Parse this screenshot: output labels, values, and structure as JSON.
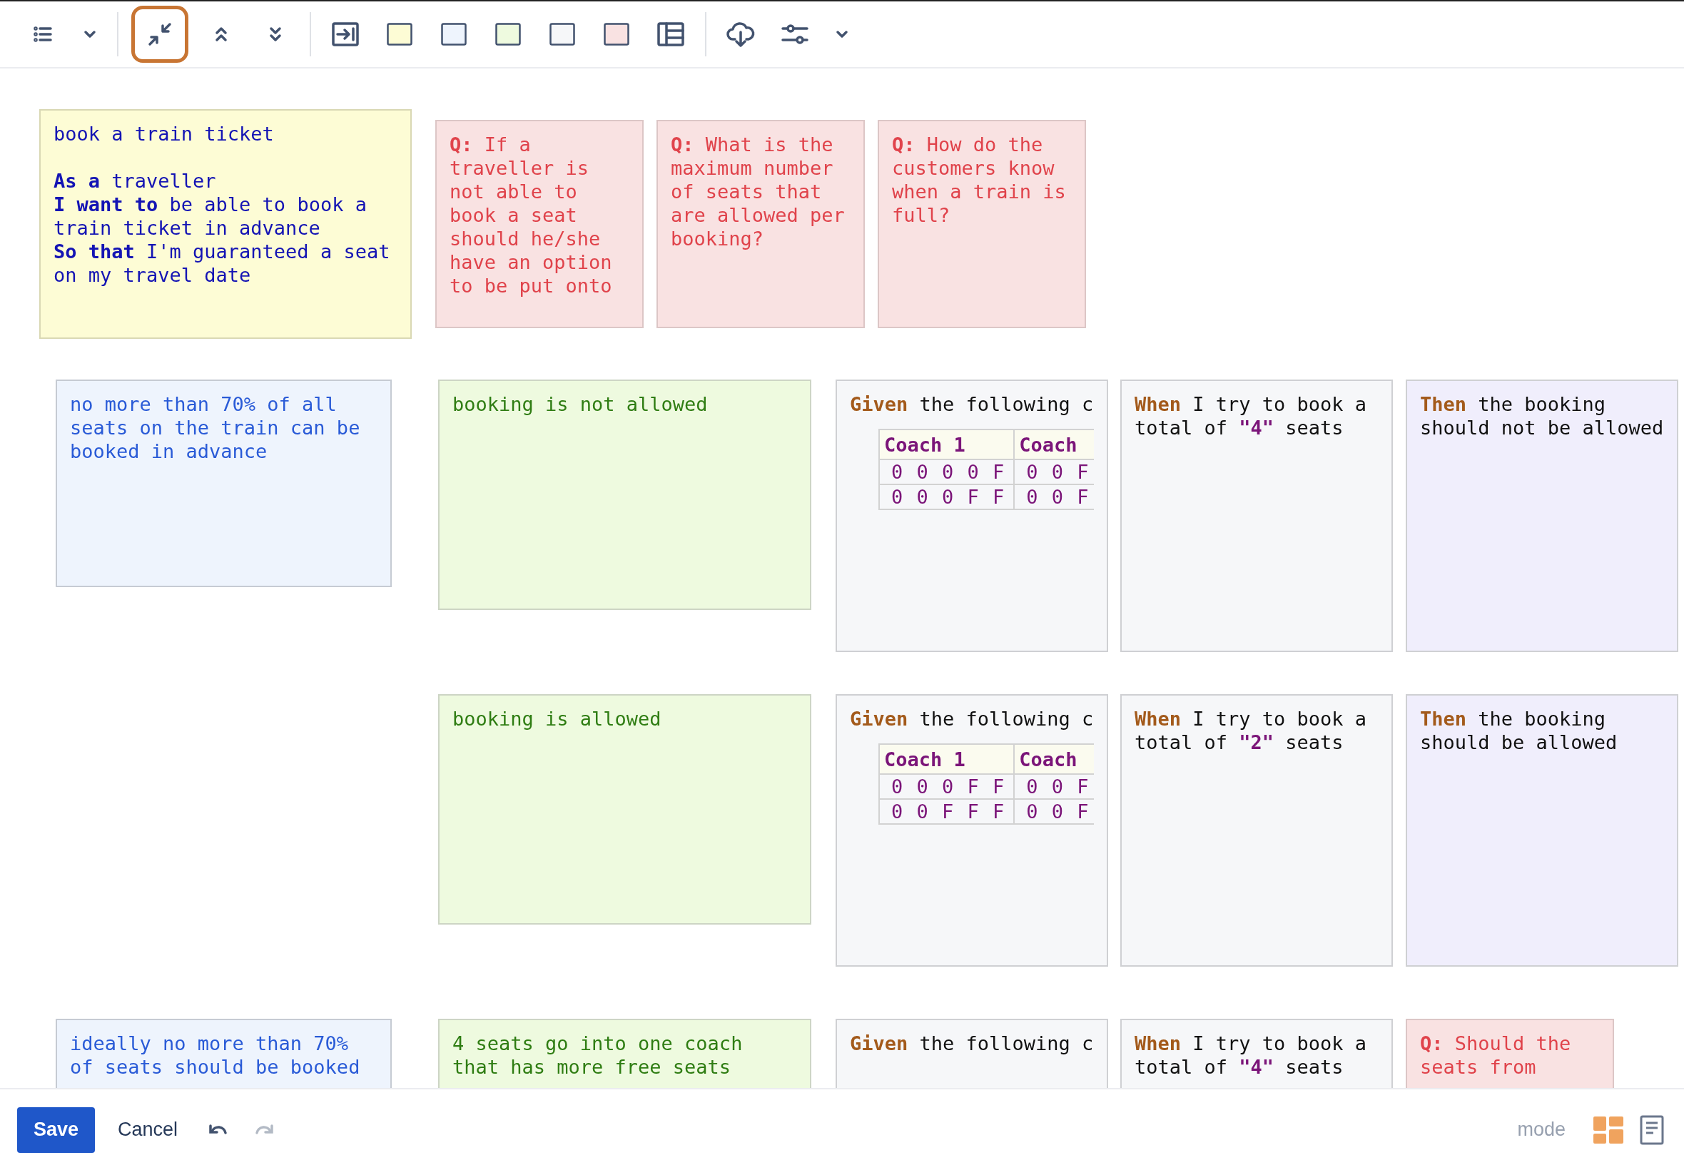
{
  "toolbar": {
    "groups": [
      [
        {
          "kind": "list",
          "selected": false
        },
        {
          "kind": "caret",
          "selected": false
        }
      ],
      [
        {
          "kind": "collapse",
          "selected": true
        },
        {
          "kind": "chevrons-up",
          "selected": false
        },
        {
          "kind": "chevrons-down",
          "selected": false
        }
      ],
      [
        {
          "kind": "indent",
          "selected": false
        },
        {
          "kind": "swatch",
          "color": "#fdfcd5",
          "selected": false
        },
        {
          "kind": "swatch",
          "color": "#eef4fd",
          "selected": false
        },
        {
          "kind": "swatch",
          "color": "#eefadf",
          "selected": false
        },
        {
          "kind": "swatch",
          "color": "#f6f7f9",
          "selected": false
        },
        {
          "kind": "swatch",
          "color": "#f9e2e2",
          "selected": false
        },
        {
          "kind": "table",
          "selected": false
        }
      ],
      [
        {
          "kind": "cloud",
          "selected": false
        },
        {
          "kind": "sliders",
          "selected": false
        },
        {
          "kind": "caret",
          "selected": false
        }
      ]
    ]
  },
  "story": {
    "title": "book a train ticket",
    "lines": [
      "**As a** traveller",
      "**I want to** be able to book a train ticket in advance",
      "**So that** I'm guaranteed a seat on my travel date"
    ]
  },
  "questions": [
    "**Q:** If a traveller is not able to book a seat should he/she have an option to be put onto",
    "**Q:** What is the maximum number of seats that are allowed per booking?",
    "**Q:** How do the customers know when a train is full?"
  ],
  "rules": [
    {
      "text": "no more than 70% of all seats on the train can be booked in advance",
      "examples": [
        {
          "text": "booking is not allowed",
          "given": {
            "text": "**Given** the following c",
            "table": {
              "columns": [
                "Coach 1",
                "Coach"
              ],
              "rows": [
                [
                  "0 0 0 0 F",
                  "0 0 F"
                ],
                [
                  "0 0 0 F F",
                  "0 0 F"
                ]
              ]
            }
          },
          "when": "**When** I try to book a total of **\"4\"** seats",
          "outcome": {
            "kind": "then",
            "text": "**Then** the booking should not be allowed"
          }
        },
        {
          "text": "booking is allowed",
          "given": {
            "text": "**Given** the following c",
            "table": {
              "columns": [
                "Coach 1",
                "Coach"
              ],
              "rows": [
                [
                  "0 0 0 F F",
                  "0 0 F"
                ],
                [
                  "0 0 F F F",
                  "0 0 F"
                ]
              ]
            }
          },
          "when": "**When** I try to book a total of **\"2\"** seats",
          "outcome": {
            "kind": "then",
            "text": "**Then** the booking should be allowed"
          }
        }
      ]
    },
    {
      "text": "ideally no more than 70% of seats should be booked",
      "examples": [
        {
          "text": "4 seats go into one coach that has more free seats",
          "given": {
            "text": "**Given** the following c"
          },
          "when": "**When** I try to book a total of **\"4\"** seats",
          "outcome": {
            "kind": "question",
            "text": "**Q:** Should the seats from"
          }
        }
      ]
    }
  ],
  "footer": {
    "save": "Save",
    "cancel": "Cancel",
    "history": [
      {
        "kind": "undo",
        "disabled": false
      },
      {
        "kind": "redo",
        "disabled": true
      }
    ],
    "mode_label": "mode",
    "modes": [
      {
        "kind": "board",
        "selected": true
      },
      {
        "kind": "document",
        "selected": false
      }
    ]
  }
}
